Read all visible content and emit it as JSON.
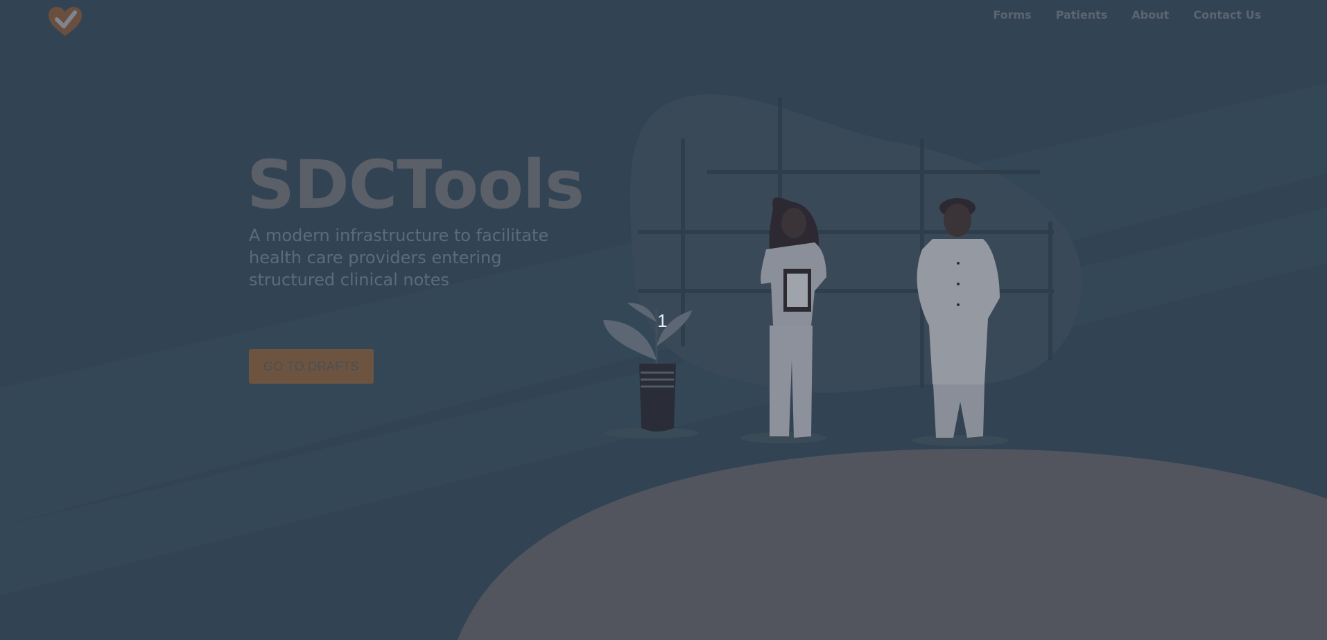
{
  "nav": {
    "items": [
      {
        "label": "Forms"
      },
      {
        "label": "Patients"
      },
      {
        "label": "About"
      },
      {
        "label": "Contact Us"
      }
    ]
  },
  "hero": {
    "title": "SDCTools",
    "subtitle": "A modern infrastructure to facilitate health care providers entering structured clinical notes",
    "cta_label": "GO TO DRAFTS"
  },
  "marker": {
    "label": "1"
  },
  "colors": {
    "background": "#324454",
    "accent_button": "#6c5441",
    "floor": "#52555e"
  },
  "icons": {
    "logo": "heart-check-icon"
  }
}
